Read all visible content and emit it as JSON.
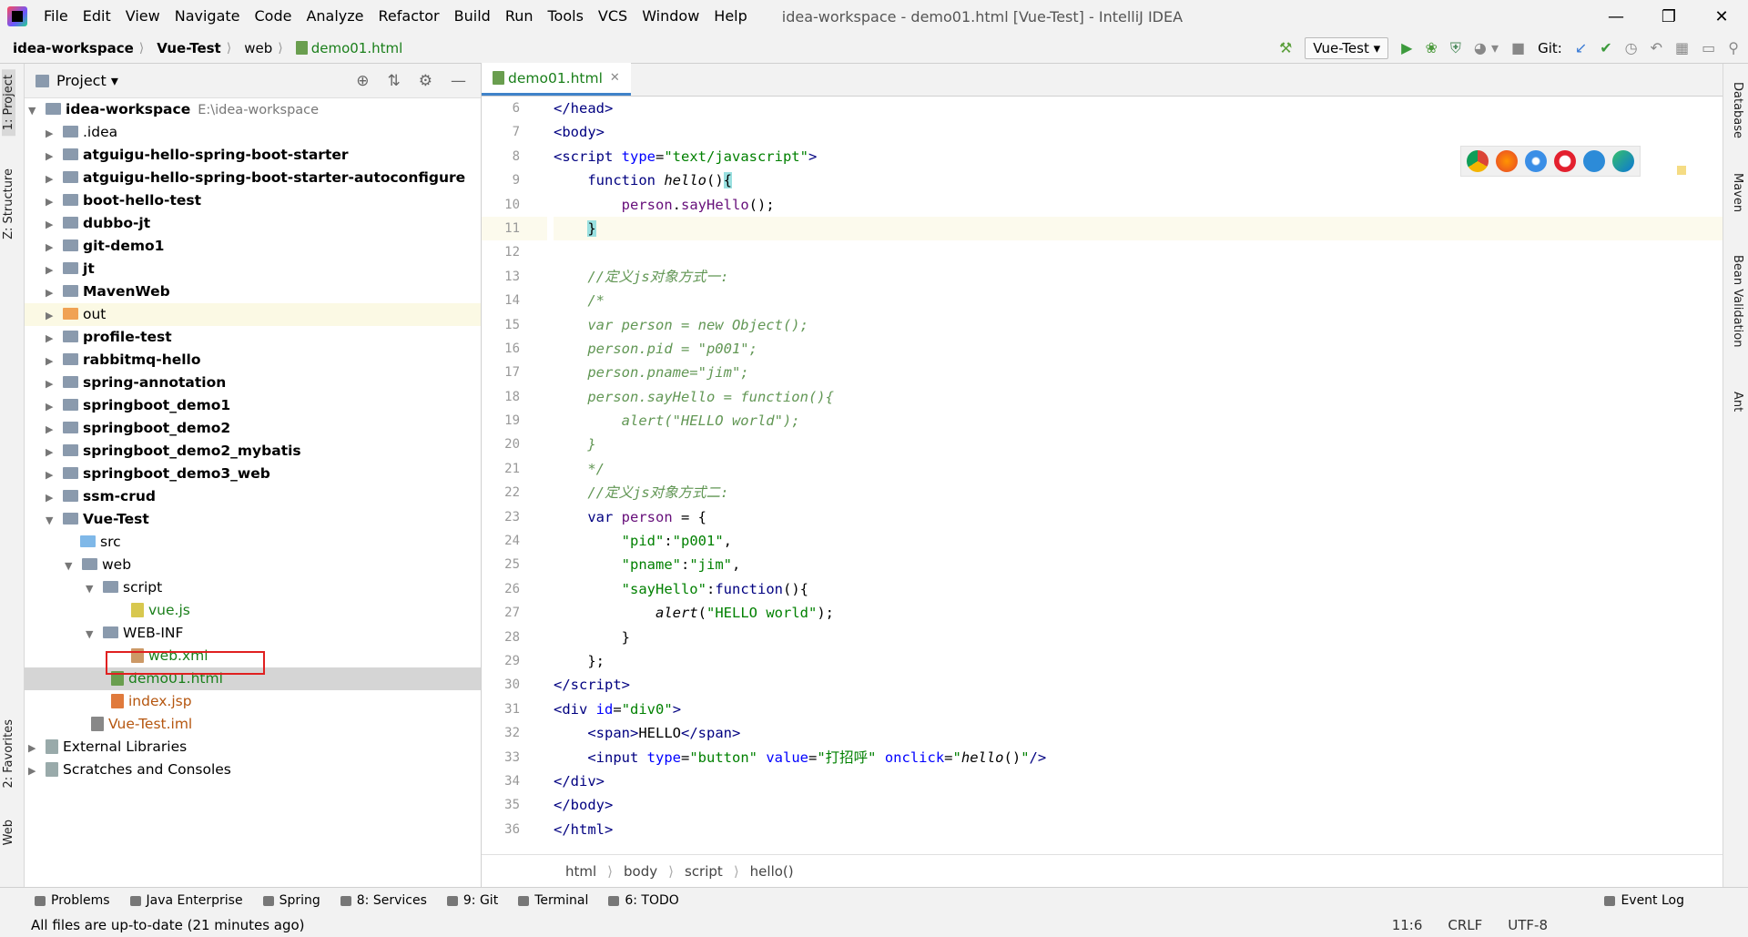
{
  "window": {
    "title": "idea-workspace - demo01.html [Vue-Test] - IntelliJ IDEA"
  },
  "menu": [
    "File",
    "Edit",
    "View",
    "Navigate",
    "Code",
    "Analyze",
    "Refactor",
    "Build",
    "Run",
    "Tools",
    "VCS",
    "Window",
    "Help"
  ],
  "navbar": {
    "crumbs": [
      "idea-workspace",
      "Vue-Test",
      "web",
      "demo01.html"
    ],
    "run_config": "Vue-Test",
    "git_label": "Git:"
  },
  "left_tabs": [
    "1: Project",
    "Z: Structure",
    "2: Favorites",
    "Web"
  ],
  "right_tabs": [
    "Database",
    "Maven",
    "Bean Validation",
    "Ant"
  ],
  "project": {
    "title": "Project",
    "root": {
      "name": "idea-workspace",
      "path": "E:\\idea-workspace"
    },
    "items": [
      {
        "name": ".idea"
      },
      {
        "name": "atguigu-hello-spring-boot-starter"
      },
      {
        "name": "atguigu-hello-spring-boot-starter-autoconfigure"
      },
      {
        "name": "boot-hello-test"
      },
      {
        "name": "dubbo-jt"
      },
      {
        "name": "git-demo1"
      },
      {
        "name": "jt"
      },
      {
        "name": "MavenWeb"
      },
      {
        "name": "out"
      },
      {
        "name": "profile-test"
      },
      {
        "name": "rabbitmq-hello"
      },
      {
        "name": "spring-annotation"
      },
      {
        "name": "springboot_demo1"
      },
      {
        "name": "springboot_demo2"
      },
      {
        "name": "springboot_demo2_mybatis"
      },
      {
        "name": "springboot_demo3_web"
      },
      {
        "name": "ssm-crud"
      },
      {
        "name": "Vue-Test"
      },
      {
        "name": "src"
      },
      {
        "name": "web"
      },
      {
        "name": "script"
      },
      {
        "name": "vue.js"
      },
      {
        "name": "WEB-INF"
      },
      {
        "name": "web.xml"
      },
      {
        "name": "demo01.html"
      },
      {
        "name": "index.jsp"
      },
      {
        "name": "Vue-Test.iml"
      },
      {
        "name": "External Libraries"
      },
      {
        "name": "Scratches and Consoles"
      }
    ]
  },
  "editor": {
    "tab": "demo01.html",
    "line_numbers": [
      "6",
      "7",
      "8",
      "9",
      "10",
      "11",
      "12",
      "13",
      "14",
      "15",
      "16",
      "17",
      "18",
      "19",
      "20",
      "21",
      "22",
      "23",
      "24",
      "25",
      "26",
      "27",
      "28",
      "29",
      "30",
      "31",
      "32",
      "33",
      "34",
      "35",
      "36"
    ],
    "breadcrumbs": [
      "html",
      "body",
      "script",
      "hello()"
    ]
  },
  "toolwindows": [
    "Problems",
    "Java Enterprise",
    "Spring",
    "8: Services",
    "9: Git",
    "Terminal",
    "6: TODO"
  ],
  "event_log": "Event Log",
  "status": {
    "message": "All files are up-to-date (21 minutes ago)",
    "position": "11:6",
    "line_sep": "CRLF",
    "encoding": "UTF-8"
  }
}
